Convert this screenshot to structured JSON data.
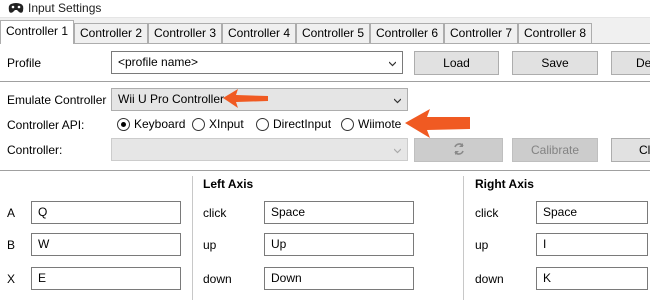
{
  "window": {
    "title": "Input Settings"
  },
  "tabs": [
    {
      "label": "Controller 1",
      "active": true
    },
    {
      "label": "Controller 2"
    },
    {
      "label": "Controller 3"
    },
    {
      "label": "Controller 4"
    },
    {
      "label": "Controller 5"
    },
    {
      "label": "Controller 6"
    },
    {
      "label": "Controller 7"
    },
    {
      "label": "Controller 8"
    }
  ],
  "profile": {
    "label": "Profile",
    "value": "<profile name>",
    "load_label": "Load",
    "save_label": "Save",
    "delete_label": "De"
  },
  "emulate": {
    "label": "Emulate Controller",
    "value": "Wii U Pro Controller"
  },
  "api": {
    "label": "Controller API:",
    "options": [
      "Keyboard",
      "XInput",
      "DirectInput",
      "Wiimote"
    ],
    "selected": "Keyboard"
  },
  "controller": {
    "label": "Controller:",
    "value": "",
    "calibrate_label": "Calibrate",
    "clear_label": "Cl"
  },
  "buttons": [
    {
      "name": "A",
      "value": "Q"
    },
    {
      "name": "B",
      "value": "W"
    },
    {
      "name": "X",
      "value": "E"
    }
  ],
  "left_axis": {
    "title": "Left Axis",
    "rows": [
      {
        "name": "click",
        "value": "Space"
      },
      {
        "name": "up",
        "value": "Up"
      },
      {
        "name": "down",
        "value": "Down"
      }
    ]
  },
  "right_axis": {
    "title": "Right Axis",
    "rows": [
      {
        "name": "click",
        "value": "Space"
      },
      {
        "name": "up",
        "value": "I"
      },
      {
        "name": "down",
        "value": "K"
      }
    ]
  },
  "colors": {
    "annotation_arrow": "#f05a22",
    "tab_border": "#adadad",
    "button_face": "#e1e1e1"
  },
  "icons": [
    "gamepad-icon",
    "chevron-down-icon",
    "refresh-icon",
    "annotation-arrow"
  ]
}
